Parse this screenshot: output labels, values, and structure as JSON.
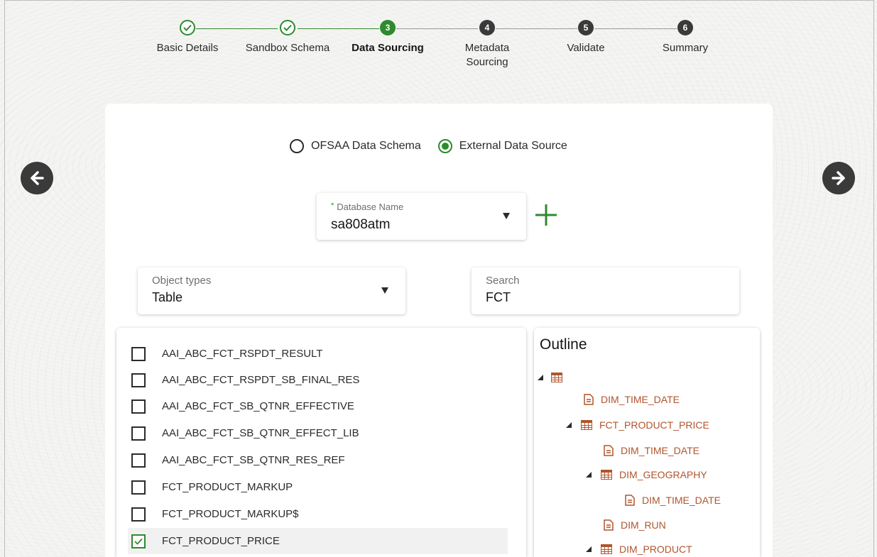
{
  "stepper": {
    "steps": [
      {
        "number": "1",
        "label": "Basic Details",
        "state": "done"
      },
      {
        "number": "2",
        "label": "Sandbox Schema",
        "state": "done"
      },
      {
        "number": "3",
        "label": "Data Sourcing",
        "state": "active"
      },
      {
        "number": "4",
        "label": "Metadata Sourcing",
        "state": "todo"
      },
      {
        "number": "5",
        "label": "Validate",
        "state": "todo"
      },
      {
        "number": "6",
        "label": "Summary",
        "state": "todo"
      }
    ]
  },
  "source_options": {
    "ofsaa_label": "OFSAA Data Schema",
    "external_label": "External Data Source",
    "selected": "external"
  },
  "database": {
    "label": "Database Name",
    "required_marker": "*",
    "value": "sa808atm"
  },
  "object_types": {
    "label": "Object types",
    "value": "Table"
  },
  "search": {
    "label": "Search",
    "value": "FCT"
  },
  "table_list": {
    "items": [
      {
        "name": "AAI_ABC_FCT_RSPDT_RESULT",
        "checked": false
      },
      {
        "name": "AAI_ABC_FCT_RSPDT_SB_FINAL_RES",
        "checked": false
      },
      {
        "name": "AAI_ABC_FCT_SB_QTNR_EFFECTIVE",
        "checked": false
      },
      {
        "name": "AAI_ABC_FCT_SB_QTNR_EFFECT_LIB",
        "checked": false
      },
      {
        "name": "AAI_ABC_FCT_SB_QTNR_RES_REF",
        "checked": false
      },
      {
        "name": "FCT_PRODUCT_MARKUP",
        "checked": false
      },
      {
        "name": "FCT_PRODUCT_MARKUP$",
        "checked": false
      },
      {
        "name": "FCT_PRODUCT_PRICE",
        "checked": true
      }
    ]
  },
  "outline": {
    "title": "Outline",
    "nodes": [
      {
        "label": "",
        "kind": "table",
        "expanded": true
      },
      {
        "label": "DIM_TIME_DATE",
        "kind": "file",
        "expanded": false
      },
      {
        "label": "FCT_PRODUCT_PRICE",
        "kind": "table",
        "expanded": true
      },
      {
        "label": "DIM_TIME_DATE",
        "kind": "file",
        "expanded": false
      },
      {
        "label": "DIM_GEOGRAPHY",
        "kind": "table",
        "expanded": true
      },
      {
        "label": "DIM_TIME_DATE",
        "kind": "file",
        "expanded": false
      },
      {
        "label": "DIM_RUN",
        "kind": "file",
        "expanded": false
      },
      {
        "label": "DIM_PRODUCT",
        "kind": "table",
        "expanded": true
      }
    ]
  },
  "colors": {
    "accent_green": "#2e8a2e",
    "tree_text": "#b0552c",
    "dark": "#3a3a3a"
  }
}
